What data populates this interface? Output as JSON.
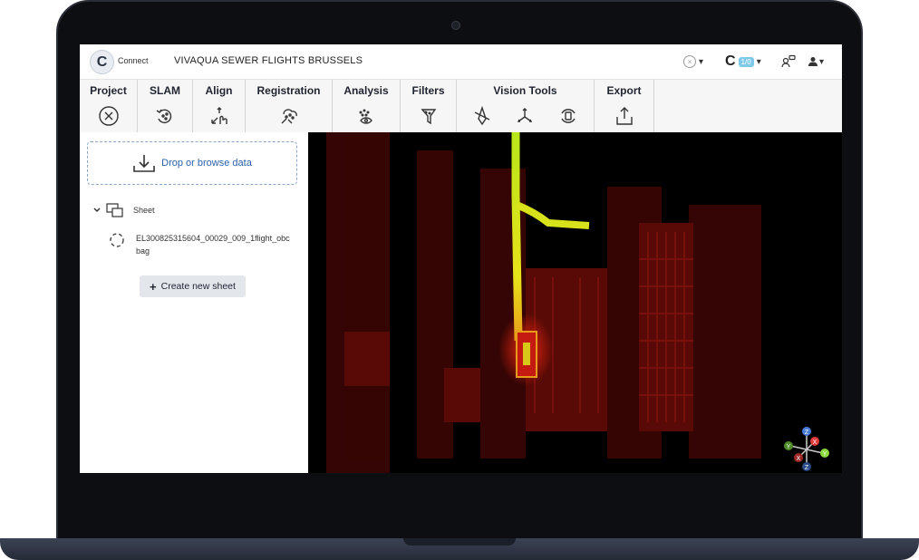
{
  "app": {
    "logo_letter": "C",
    "logo_text": "Connect",
    "project_title": "VIVAQUA SEWER FLIGHTS BRUSSELS"
  },
  "topbar": {
    "close_symbol": "×",
    "dropdown_symbol": "▾",
    "credits_logo": "C",
    "credits_badge": "1/0"
  },
  "ribbon": {
    "groups": [
      {
        "label": "Project",
        "icons": [
          "close-circle-icon"
        ]
      },
      {
        "label": "SLAM",
        "icons": [
          "slam-loop-icon"
        ]
      },
      {
        "label": "Align",
        "icons": [
          "align-hand-icon"
        ]
      },
      {
        "label": "Registration",
        "icons": [
          "registration-icon"
        ]
      },
      {
        "label": "Analysis",
        "icons": [
          "analysis-eye-icon"
        ]
      },
      {
        "label": "Filters",
        "icons": [
          "filter-icon"
        ]
      },
      {
        "label": "Vision Tools",
        "icons": [
          "vision-pen-icon",
          "axes-icon",
          "capture-icon"
        ]
      },
      {
        "label": "Export",
        "icons": [
          "export-upload-icon"
        ]
      }
    ]
  },
  "sidebar": {
    "dropzone_label": "Drop or browse data",
    "sheet_label": "Sheet",
    "file_name": "EL300825315604_00029_009_1flight_obcbag",
    "create_sheet_label": "Create new sheet"
  },
  "axes": {
    "z": "Z",
    "x": "X",
    "y": "Y",
    "neg_y": "Y",
    "neg_x": "X",
    "neg_z": "Z"
  },
  "colors": {
    "accent": "#2b5fa8",
    "pointcloud_red": "#c41a12",
    "pointcloud_yellow": "#e8e21a",
    "laptop_frame": "#0d0e12"
  }
}
